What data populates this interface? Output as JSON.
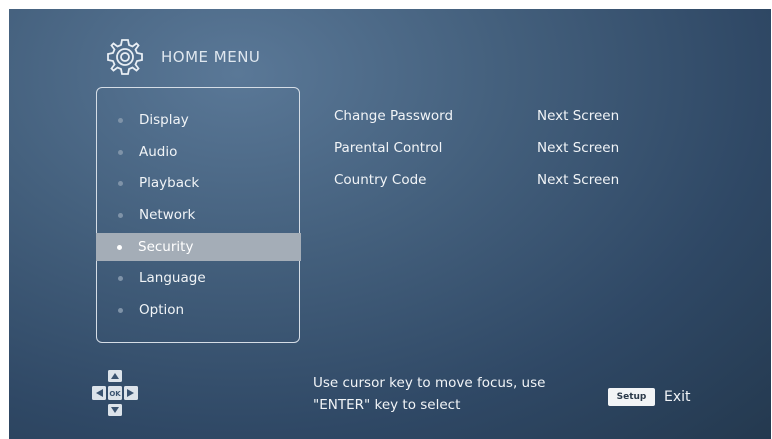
{
  "header": {
    "title": "HOME MENU",
    "icon": "gear-icon"
  },
  "menu": {
    "selected_index": 4,
    "items": [
      {
        "label": "Display"
      },
      {
        "label": "Audio"
      },
      {
        "label": "Playback"
      },
      {
        "label": "Network"
      },
      {
        "label": "Security"
      },
      {
        "label": "Language"
      },
      {
        "label": "Option"
      }
    ]
  },
  "options": [
    {
      "name": "Change Password",
      "value": "Next Screen"
    },
    {
      "name": "Parental Control",
      "value": "Next Screen"
    },
    {
      "name": "Country Code",
      "value": "Next Screen"
    }
  ],
  "footer": {
    "dpad_center_label": "OK",
    "help_text": "Use cursor key to move focus, use\n\"ENTER\" key to select",
    "setup_key_label": "Setup",
    "exit_label": "Exit"
  },
  "colors": {
    "background": "#3f5a77",
    "selection": "#a4adb7",
    "text": "#f1f4f7"
  }
}
